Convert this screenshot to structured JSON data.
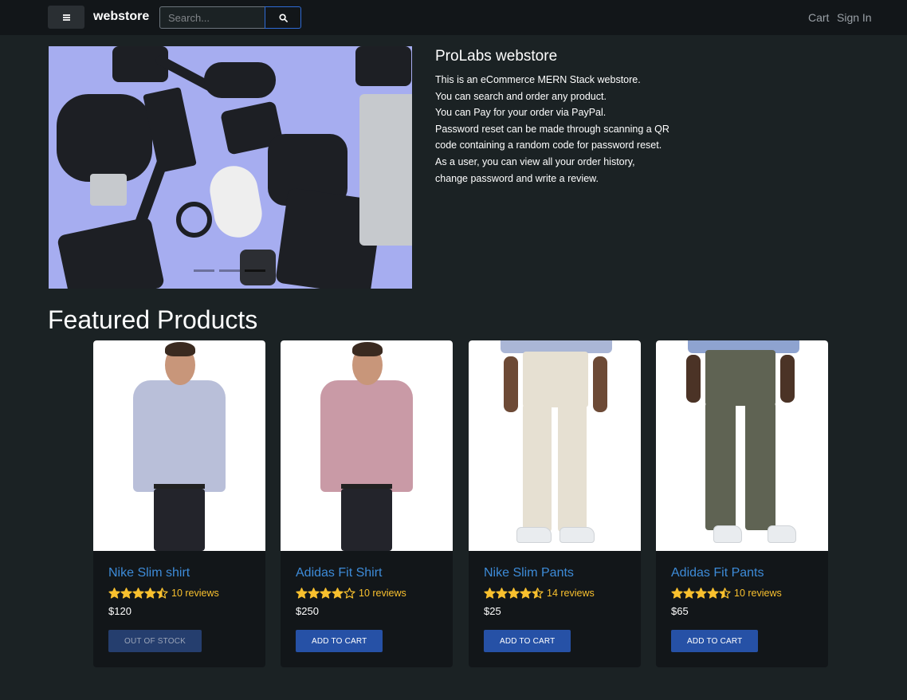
{
  "navbar": {
    "brand": "webstore",
    "search_placeholder": "Search...",
    "links": {
      "cart": "Cart",
      "signin": "Sign In"
    }
  },
  "hero": {
    "title": "ProLabs webstore",
    "lines": [
      "This is an eCommerce MERN Stack webstore.",
      "You can search and order any product.",
      "You can Pay for your order via PayPal.",
      "Password reset can be made through scanning a QR",
      "code containing a random code for password reset.",
      "As a user, you can view all your order history,",
      "change password and write a review."
    ],
    "carousel_active_slide": 3
  },
  "featured": {
    "title": "Featured Products",
    "products": [
      {
        "name": "Nike Slim shirt",
        "rating": 4.5,
        "reviews": "10 reviews",
        "price": "$120",
        "button": "OUT OF STOCK",
        "in_stock": false
      },
      {
        "name": "Adidas Fit Shirt",
        "rating": 4.0,
        "reviews": "10 reviews",
        "price": "$250",
        "button": "ADD TO CART",
        "in_stock": true
      },
      {
        "name": "Nike Slim Pants",
        "rating": 4.5,
        "reviews": "14 reviews",
        "price": "$25",
        "button": "ADD TO CART",
        "in_stock": true
      },
      {
        "name": "Adidas Fit Pants",
        "rating": 4.5,
        "reviews": "10 reviews",
        "price": "$65",
        "button": "ADD TO CART",
        "in_stock": true
      }
    ]
  },
  "colors": {
    "background": "#1b2224",
    "navbar": "#121619",
    "accent_link": "#3d8bd8",
    "star": "#f8c02e",
    "button": "#2651a6"
  }
}
